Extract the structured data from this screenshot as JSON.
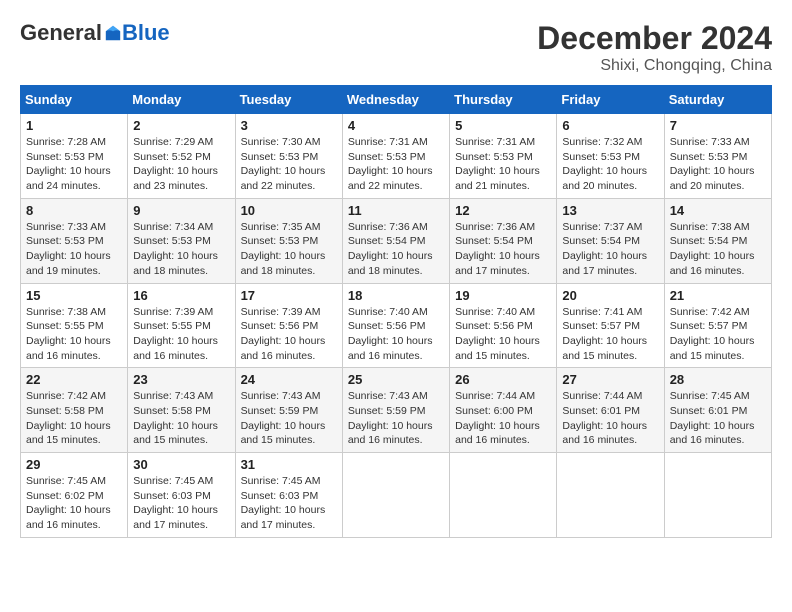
{
  "header": {
    "logo_general": "General",
    "logo_blue": "Blue",
    "month": "December 2024",
    "location": "Shixi, Chongqing, China"
  },
  "weekdays": [
    "Sunday",
    "Monday",
    "Tuesday",
    "Wednesday",
    "Thursday",
    "Friday",
    "Saturday"
  ],
  "weeks": [
    [
      {
        "day": "1",
        "sunrise": "7:28 AM",
        "sunset": "5:53 PM",
        "daylight": "10 hours and 24 minutes."
      },
      {
        "day": "2",
        "sunrise": "7:29 AM",
        "sunset": "5:52 PM",
        "daylight": "10 hours and 23 minutes."
      },
      {
        "day": "3",
        "sunrise": "7:30 AM",
        "sunset": "5:53 PM",
        "daylight": "10 hours and 22 minutes."
      },
      {
        "day": "4",
        "sunrise": "7:31 AM",
        "sunset": "5:53 PM",
        "daylight": "10 hours and 22 minutes."
      },
      {
        "day": "5",
        "sunrise": "7:31 AM",
        "sunset": "5:53 PM",
        "daylight": "10 hours and 21 minutes."
      },
      {
        "day": "6",
        "sunrise": "7:32 AM",
        "sunset": "5:53 PM",
        "daylight": "10 hours and 20 minutes."
      },
      {
        "day": "7",
        "sunrise": "7:33 AM",
        "sunset": "5:53 PM",
        "daylight": "10 hours and 20 minutes."
      }
    ],
    [
      {
        "day": "8",
        "sunrise": "7:33 AM",
        "sunset": "5:53 PM",
        "daylight": "10 hours and 19 minutes."
      },
      {
        "day": "9",
        "sunrise": "7:34 AM",
        "sunset": "5:53 PM",
        "daylight": "10 hours and 18 minutes."
      },
      {
        "day": "10",
        "sunrise": "7:35 AM",
        "sunset": "5:53 PM",
        "daylight": "10 hours and 18 minutes."
      },
      {
        "day": "11",
        "sunrise": "7:36 AM",
        "sunset": "5:54 PM",
        "daylight": "10 hours and 18 minutes."
      },
      {
        "day": "12",
        "sunrise": "7:36 AM",
        "sunset": "5:54 PM",
        "daylight": "10 hours and 17 minutes."
      },
      {
        "day": "13",
        "sunrise": "7:37 AM",
        "sunset": "5:54 PM",
        "daylight": "10 hours and 17 minutes."
      },
      {
        "day": "14",
        "sunrise": "7:38 AM",
        "sunset": "5:54 PM",
        "daylight": "10 hours and 16 minutes."
      }
    ],
    [
      {
        "day": "15",
        "sunrise": "7:38 AM",
        "sunset": "5:55 PM",
        "daylight": "10 hours and 16 minutes."
      },
      {
        "day": "16",
        "sunrise": "7:39 AM",
        "sunset": "5:55 PM",
        "daylight": "10 hours and 16 minutes."
      },
      {
        "day": "17",
        "sunrise": "7:39 AM",
        "sunset": "5:56 PM",
        "daylight": "10 hours and 16 minutes."
      },
      {
        "day": "18",
        "sunrise": "7:40 AM",
        "sunset": "5:56 PM",
        "daylight": "10 hours and 16 minutes."
      },
      {
        "day": "19",
        "sunrise": "7:40 AM",
        "sunset": "5:56 PM",
        "daylight": "10 hours and 15 minutes."
      },
      {
        "day": "20",
        "sunrise": "7:41 AM",
        "sunset": "5:57 PM",
        "daylight": "10 hours and 15 minutes."
      },
      {
        "day": "21",
        "sunrise": "7:42 AM",
        "sunset": "5:57 PM",
        "daylight": "10 hours and 15 minutes."
      }
    ],
    [
      {
        "day": "22",
        "sunrise": "7:42 AM",
        "sunset": "5:58 PM",
        "daylight": "10 hours and 15 minutes."
      },
      {
        "day": "23",
        "sunrise": "7:43 AM",
        "sunset": "5:58 PM",
        "daylight": "10 hours and 15 minutes."
      },
      {
        "day": "24",
        "sunrise": "7:43 AM",
        "sunset": "5:59 PM",
        "daylight": "10 hours and 15 minutes."
      },
      {
        "day": "25",
        "sunrise": "7:43 AM",
        "sunset": "5:59 PM",
        "daylight": "10 hours and 16 minutes."
      },
      {
        "day": "26",
        "sunrise": "7:44 AM",
        "sunset": "6:00 PM",
        "daylight": "10 hours and 16 minutes."
      },
      {
        "day": "27",
        "sunrise": "7:44 AM",
        "sunset": "6:01 PM",
        "daylight": "10 hours and 16 minutes."
      },
      {
        "day": "28",
        "sunrise": "7:45 AM",
        "sunset": "6:01 PM",
        "daylight": "10 hours and 16 minutes."
      }
    ],
    [
      {
        "day": "29",
        "sunrise": "7:45 AM",
        "sunset": "6:02 PM",
        "daylight": "10 hours and 16 minutes."
      },
      {
        "day": "30",
        "sunrise": "7:45 AM",
        "sunset": "6:03 PM",
        "daylight": "10 hours and 17 minutes."
      },
      {
        "day": "31",
        "sunrise": "7:45 AM",
        "sunset": "6:03 PM",
        "daylight": "10 hours and 17 minutes."
      },
      null,
      null,
      null,
      null
    ]
  ]
}
